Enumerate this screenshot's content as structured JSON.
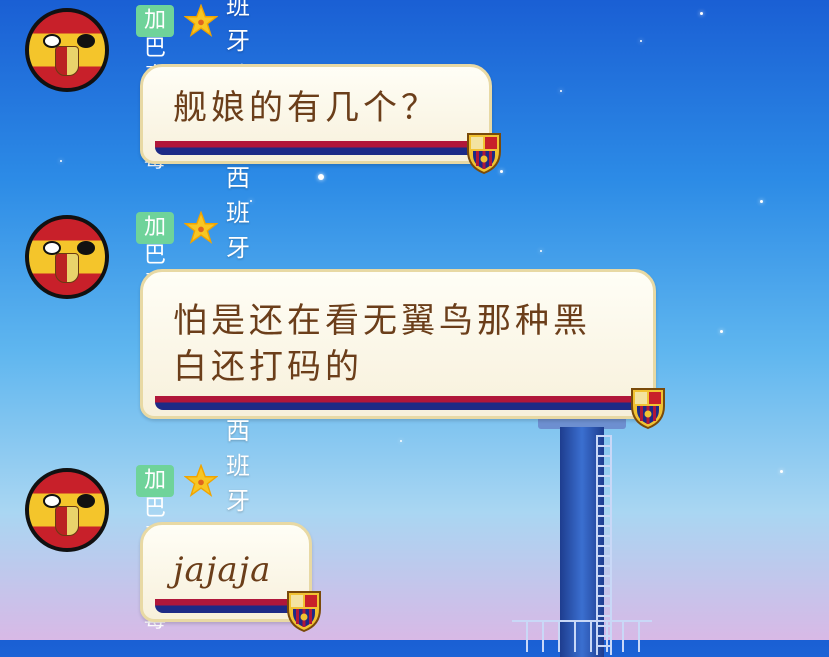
{
  "messages": [
    {
      "sender": {
        "title_badge": "加巴毒啥都毒",
        "star_icon": "star-icon",
        "nickname": "西班牙球"
      },
      "text": "舰娘的有几个？"
    },
    {
      "sender": {
        "title_badge": "加巴毒啥都毒",
        "star_icon": "star-icon",
        "nickname": "西班牙球"
      },
      "text": "怕是还在看无翼鸟那种黑白还打码的"
    },
    {
      "sender": {
        "title_badge": "加巴毒啥都毒",
        "star_icon": "star-icon",
        "nickname": "西班牙球"
      },
      "text": "jajaja"
    }
  ],
  "colors": {
    "badge_bg": "#6fd39a",
    "bubble_border": "#e8d9a4",
    "bubble_text": "#6b3e1a",
    "stripe_red": "#b0173a",
    "stripe_blue": "#1d2a86"
  },
  "icons": {
    "avatar": "spain-countryball-avatar",
    "bubble_decoration": "fc-barcelona-crest-icon"
  }
}
